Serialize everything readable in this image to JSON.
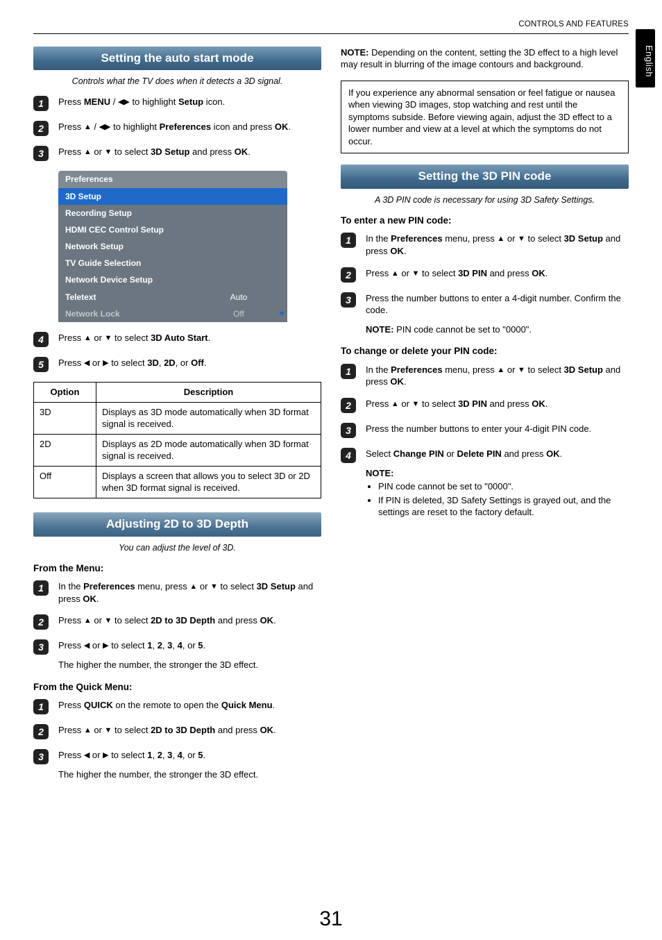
{
  "header": {
    "section_label": "CONTROLS AND FEATURES"
  },
  "lang_tab": "English",
  "page_number": "31",
  "left": {
    "sec1": {
      "title": "Setting the auto start mode",
      "subtitle": "Controls what the TV does when it detects a 3D signal.",
      "step1": {
        "p1": "Press ",
        "b1": "MENU",
        "p2": " / ",
        "p3": " to highlight ",
        "b2": "Setup",
        "p4": " icon."
      },
      "step2": {
        "p1": "Press ",
        "p2": " / ",
        "p3": " to highlight ",
        "b1": "Preferences",
        "p4": " icon and press ",
        "b2": "OK",
        "p5": "."
      },
      "step3": {
        "p1": "Press ",
        "p2": " or ",
        "p3": " to select ",
        "b1": "3D Setup",
        "p4": " and press ",
        "b2": "OK",
        "p5": "."
      },
      "prefs": {
        "title": "Preferences",
        "rows": [
          {
            "label": "3D Setup",
            "value": ""
          },
          {
            "label": "Recording Setup",
            "value": ""
          },
          {
            "label": "HDMI CEC Control Setup",
            "value": ""
          },
          {
            "label": "Network Setup",
            "value": ""
          },
          {
            "label": "TV Guide Selection",
            "value": ""
          },
          {
            "label": "Network Device Setup",
            "value": ""
          },
          {
            "label": "Teletext",
            "value": "Auto"
          },
          {
            "label": "Network Lock",
            "value": "Off"
          }
        ]
      },
      "step4": {
        "p1": "Press ",
        "p2": " or ",
        "p3": " to select ",
        "b1": "3D Auto Start",
        "p4": "."
      },
      "step5": {
        "p1": "Press ",
        "p2": " or ",
        "p3": " to select ",
        "b1": "3D",
        "c1": ", ",
        "b2": "2D",
        "c2": ", or ",
        "b3": "Off",
        "p4": "."
      },
      "table": {
        "h1": "Option",
        "h2": "Description",
        "r1": {
          "o": "3D",
          "d": "Displays as 3D mode automatically when 3D format signal is received."
        },
        "r2": {
          "o": "2D",
          "d": "Displays as 2D mode automatically when 3D format signal is received."
        },
        "r3": {
          "o": "Off",
          "d": "Displays a screen that allows you to select 3D or 2D when 3D format signal is received."
        }
      }
    },
    "sec2": {
      "title": "Adjusting 2D to 3D Depth",
      "subtitle": "You can adjust the level of 3D.",
      "h_menu": "From the Menu:",
      "m_step1": {
        "p1": "In the ",
        "b1": "Preferences",
        "p2": " menu, press ",
        "p3": " or ",
        "p4": " to select ",
        "b2": "3D Setup",
        "p5": " and press ",
        "b3": "OK",
        "p6": "."
      },
      "m_step2": {
        "p1": "Press ",
        "p2": " or ",
        "p3": " to select ",
        "b1": "2D to 3D Depth",
        "p4": " and press ",
        "b2": "OK",
        "p5": "."
      },
      "m_step3": {
        "p1": "Press ",
        "p2": " or ",
        "p3": " to select ",
        "b1": "1",
        "c1": ", ",
        "b2": "2",
        "c2": ", ",
        "b3": "3",
        "c3": ", ",
        "b4": "4",
        "c4": ", or ",
        "b5": "5",
        "p4": "."
      },
      "m_tail": "The higher the number, the stronger the 3D effect.",
      "h_quick": "From the Quick Menu:",
      "q_step1": {
        "p1": "Press ",
        "b1": "QUICK",
        "p2": " on the remote to open the ",
        "b2": "Quick Menu",
        "p3": "."
      },
      "q_step2": {
        "p1": "Press ",
        "p2": " or ",
        "p3": " to select ",
        "b1": "2D to 3D Depth",
        "p4": " and press ",
        "b2": "OK",
        "p5": "."
      },
      "q_step3": {
        "p1": "Press ",
        "p2": " or ",
        "p3": " to select ",
        "b1": "1",
        "c1": ", ",
        "b2": "2",
        "c2": ", ",
        "b3": "3",
        "c3": ", ",
        "b4": "4",
        "c4": ", or ",
        "b5": "5",
        "p4": "."
      },
      "q_tail": "The higher the number, the stronger the 3D effect."
    }
  },
  "right": {
    "note_top": {
      "nb": "NOTE:",
      "txt": " Depending on the content, setting the 3D effect to a high level may result in blurring of the image contours and background."
    },
    "warn_box": "If you experience any abnormal sensation or feel fatigue or nausea when viewing 3D images, stop watching and rest until the symptoms subside. Before viewing again, adjust the 3D effect to a lower number and view at a level at which the symptoms do not occur.",
    "sec3": {
      "title": "Setting the 3D PIN code",
      "subtitle": "A 3D PIN code is necessary for using 3D Safety Settings.",
      "h_enter": "To enter a new PIN code:",
      "e_step1": {
        "p1": "In the ",
        "b1": "Preferences",
        "p2": " menu, press ",
        "p3": " or ",
        "p4": " to select ",
        "b2": "3D Setup",
        "p5": " and press ",
        "b3": "OK",
        "p6": "."
      },
      "e_step2": {
        "p1": "Press ",
        "p2": " or ",
        "p3": " to select ",
        "b1": "3D PIN",
        "p4": " and press ",
        "b2": "OK",
        "p5": "."
      },
      "e_step3": {
        "t": "Press the number buttons to enter a 4-digit number. Confirm the code."
      },
      "e_note": {
        "nb": "NOTE:",
        "txt": " PIN code cannot be set to \"0000\"."
      },
      "h_change": "To change or delete your PIN code:",
      "c_step1": {
        "p1": "In the ",
        "b1": "Preferences",
        "p2": " menu, press ",
        "p3": " or ",
        "p4": " to select ",
        "b2": "3D Setup",
        "p5": " and press ",
        "b3": "OK",
        "p6": "."
      },
      "c_step2": {
        "p1": "Press ",
        "p2": " or ",
        "p3": " to select ",
        "b1": "3D PIN",
        "p4": " and press ",
        "b2": "OK",
        "p5": "."
      },
      "c_step3": {
        "t": "Press the number buttons to enter your 4-digit PIN code."
      },
      "c_step4": {
        "p1": "Select ",
        "b1": "Change PIN",
        "p2": " or ",
        "b2": "Delete PIN",
        "p3": " and press ",
        "b3": "OK",
        "p4": "."
      },
      "c_note_hdr": "NOTE:",
      "c_note_b1": "PIN code cannot be set to \"0000\".",
      "c_note_b2": "If PIN is deleted, 3D Safety Settings is grayed out, and the settings are reset to the factory default."
    }
  }
}
